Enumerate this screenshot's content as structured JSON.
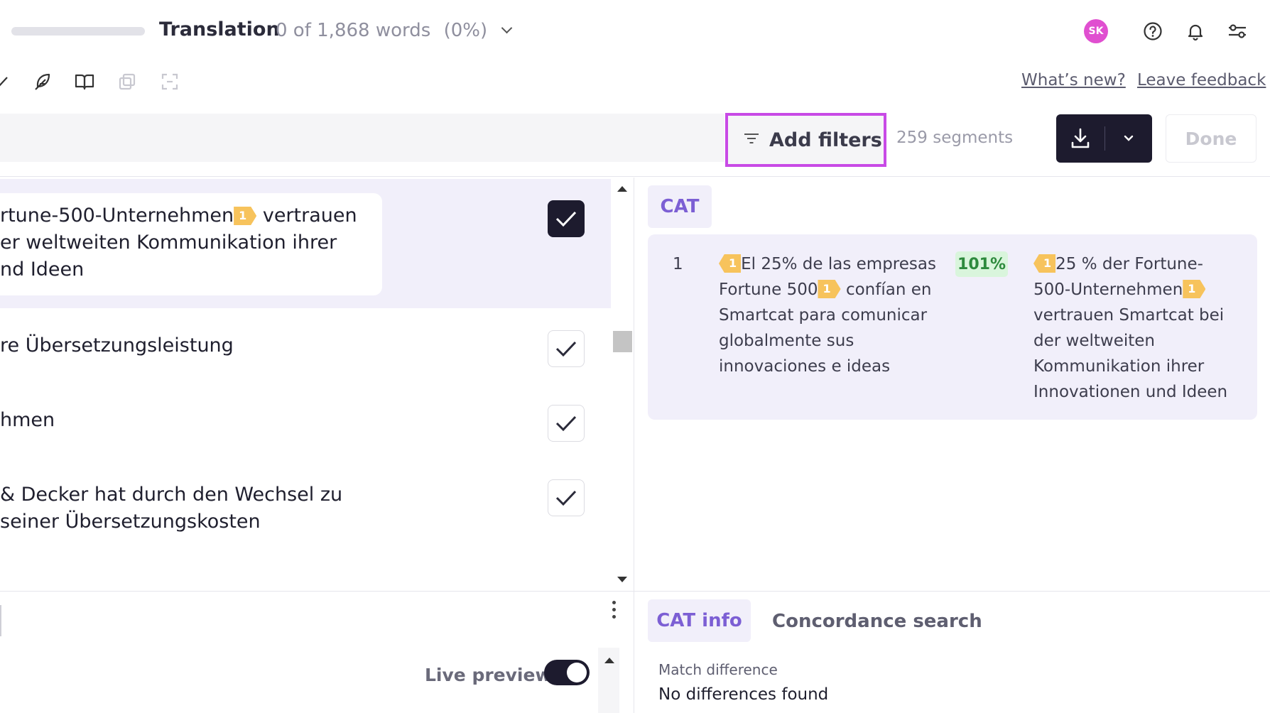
{
  "header": {
    "stage_title": "Translation",
    "word_count": "0 of 1,868 words",
    "percent": "(0%)",
    "avatar_initials": "SK"
  },
  "toolbar": {
    "whats_new": "What’s new?",
    "leave_feedback": "Leave feedback"
  },
  "filter_bar": {
    "add_filters": "Add filters",
    "segments_count": "259 segments",
    "done": "Done"
  },
  "segments": [
    {
      "lines": [
        "rtune-500-Unternehmen",
        "er weltweiten Kommunikation ihrer",
        "nd Ideen"
      ],
      "line1_tag": "1",
      "line1_after": "vertrauen",
      "confirmed": true,
      "active": true
    },
    {
      "lines": [
        "re Übersetzungsleistung"
      ],
      "confirmed": false
    },
    {
      "lines": [
        "hmen"
      ],
      "confirmed": false
    },
    {
      "lines": [
        "& Decker hat durch den Wechsel zu",
        " seiner Übersetzungskosten"
      ],
      "confirmed": false
    }
  ],
  "cat_panel": {
    "tab_label": "CAT",
    "match": {
      "index": "1",
      "percent": "101%",
      "source": {
        "tag_lead": "1",
        "line1": "El 25% de las empresas",
        "line2_a": "Fortune 500",
        "line2_tag": "1",
        "line2_b": "confían en",
        "line3": "Smartcat para comunicar",
        "line4": "globalmente sus",
        "line5": "innovaciones e ideas"
      },
      "target": {
        "tag_lead": "1",
        "line1": "25 % der Fortune-",
        "line2_a": "500-Unternehmen",
        "line2_tag": "1",
        "line3": "vertrauen Smartcat bei",
        "line4": "der weltweiten",
        "line5": "Kommunikation ihrer",
        "line6": "Innovationen und Ideen"
      }
    }
  },
  "bottom_panel": {
    "live_preview": "Live preview",
    "tabs": [
      "CAT info",
      "Concordance search"
    ],
    "match_difference_label": "Match difference",
    "match_difference_value": "No differences found"
  },
  "colors": {
    "accent_purple": "#7c5fd4",
    "highlight_border": "#c84ae6",
    "tag_yellow": "#f7c35c",
    "dark_button": "#1d1b2e",
    "match_green": "#2d8a3d"
  }
}
